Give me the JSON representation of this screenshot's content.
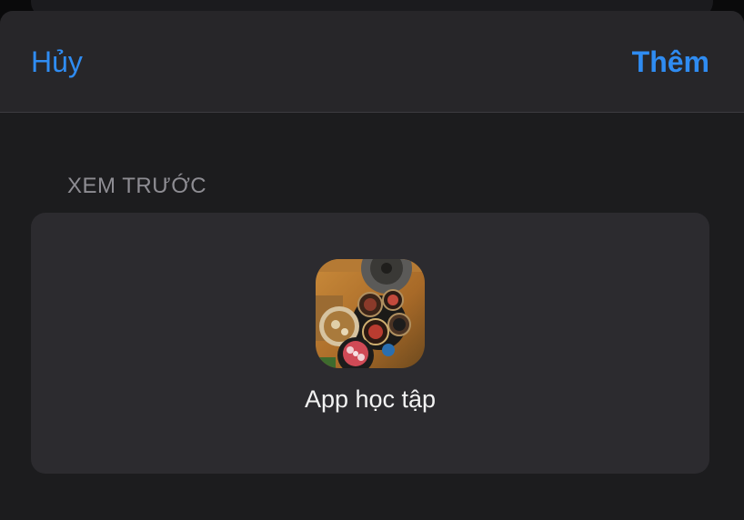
{
  "navbar": {
    "cancel_label": "Hủy",
    "add_label": "Thêm"
  },
  "preview": {
    "section_label": "XEM TRƯỚC",
    "app_name": "App học tập",
    "icon_name": "app-photo-icon"
  },
  "colors": {
    "accent": "#2f8cf2",
    "background": "#1c1c1e",
    "card": "#2c2b2f",
    "header_text": "#8e8d93"
  }
}
